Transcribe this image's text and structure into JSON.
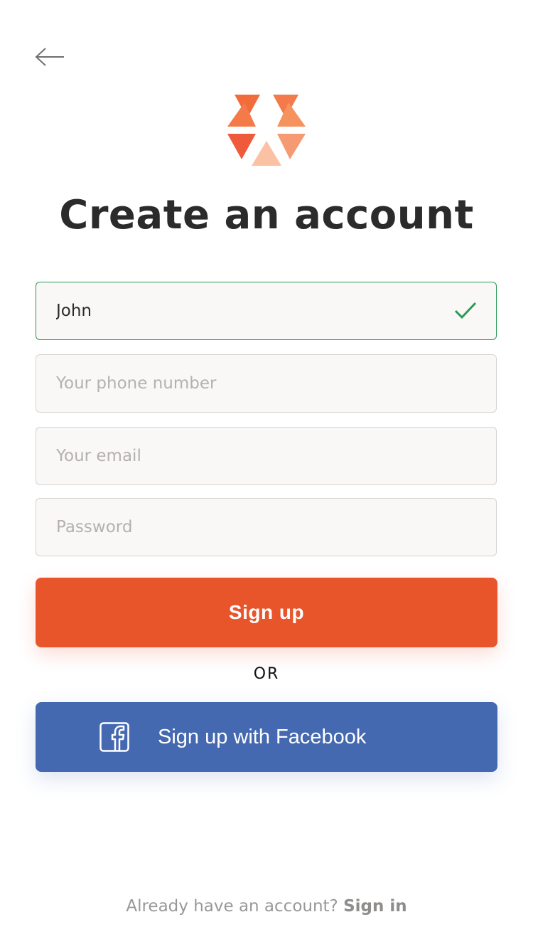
{
  "header": {
    "back_icon": "arrow-left-icon",
    "logo_icon": "hexagon-triangles-logo"
  },
  "title": "Create an account",
  "form": {
    "name": {
      "value": "John",
      "placeholder": "",
      "status": "valid",
      "icon": "check-icon"
    },
    "phone": {
      "value": "",
      "placeholder": "Your phone number"
    },
    "email": {
      "value": "",
      "placeholder": "Your email"
    },
    "password": {
      "value": "",
      "placeholder": "Password"
    }
  },
  "buttons": {
    "signup_label": "Sign up",
    "or_label": "OR",
    "facebook_label": "Sign up with Facebook",
    "facebook_icon": "facebook-icon"
  },
  "footer": {
    "prompt": "Already have an account?",
    "signin_label": "Sign in"
  },
  "colors": {
    "primary": "#e9552b",
    "facebook": "#4469b0",
    "valid": "#2a9a55",
    "logo": [
      "#f26b3a",
      "#f47a4a",
      "#f6925e",
      "#ef5a3c",
      "#fbc1a3",
      "#f59a72"
    ]
  }
}
